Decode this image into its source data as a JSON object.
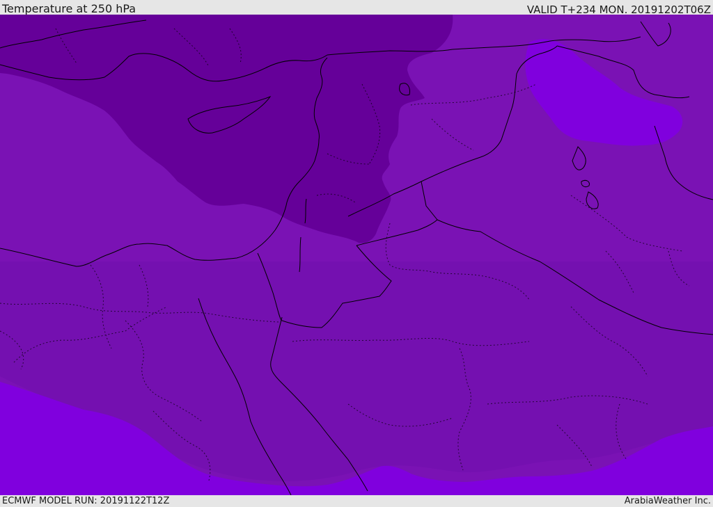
{
  "header": {
    "title": "Temperature at 250 hPa",
    "valid": "VALID T+234 MON. 20191202T06Z"
  },
  "footer": {
    "model_run": "ECMWF MODEL RUN: 20191122T12Z",
    "credit": "ArabiaWeather Inc."
  },
  "map": {
    "field": "temperature",
    "level": "250 hPa",
    "colors": {
      "coldest": "#650099",
      "cold": "#7410b0",
      "mid": "#7e12b8",
      "warm": "#8000de",
      "warm_alt": "#8506e6",
      "border": "#000000"
    }
  }
}
